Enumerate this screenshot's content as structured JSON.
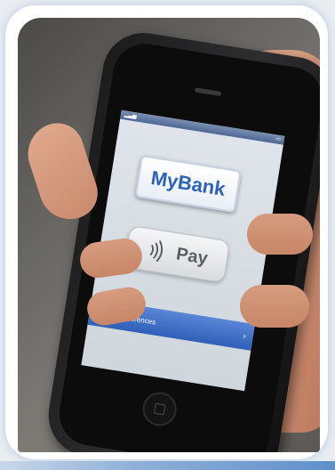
{
  "app": {
    "brand_label": "MyBank",
    "pay_label": "Pay",
    "preferences_label": "Preferences"
  },
  "icons": {
    "contactless": "nfc-icon",
    "settings": "gear-icon",
    "disclosure": "chevron-right-icon"
  },
  "colors": {
    "brand_blue": "#2d62b8",
    "nav_bar_blue": "#3f6fc6",
    "frame_accent": "#5f8fcc"
  }
}
